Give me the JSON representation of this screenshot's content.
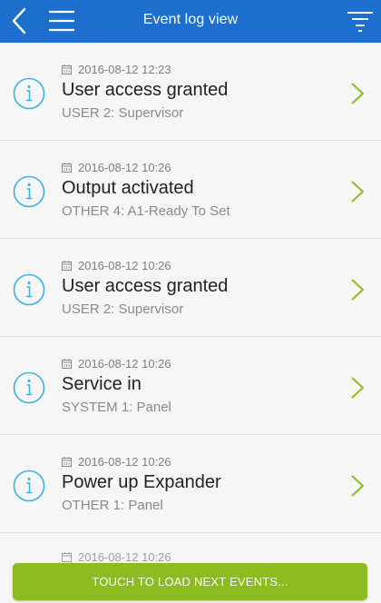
{
  "header": {
    "title": "Event log view",
    "back_icon": "back-chevron-icon",
    "menu_icon": "hamburger-menu-icon",
    "filter_icon": "filter-icon"
  },
  "colors": {
    "header_bg": "#1d6fce",
    "info_icon": "#3ab1e3",
    "chevron": "#8cbc1f",
    "button_bg": "#8cbc1f"
  },
  "events": [
    {
      "date": "2016-08-12 12:23",
      "title": "User access granted",
      "subtitle": "USER 2: Supervisor"
    },
    {
      "date": "2016-08-12 10:26",
      "title": "Output activated",
      "subtitle": "OTHER 4: A1-Ready To Set"
    },
    {
      "date": "2016-08-12 10:26",
      "title": "User access granted",
      "subtitle": "USER 2: Supervisor"
    },
    {
      "date": "2016-08-12 10:26",
      "title": "Service in",
      "subtitle": "SYSTEM 1: Panel"
    },
    {
      "date": "2016-08-12 10:26",
      "title": "Power up Expander",
      "subtitle": "OTHER 1: Panel"
    }
  ],
  "partial_event": {
    "date": "2016-08-12 10:26"
  },
  "load_button": {
    "label": "TOUCH TO LOAD NEXT EVENTS..."
  }
}
